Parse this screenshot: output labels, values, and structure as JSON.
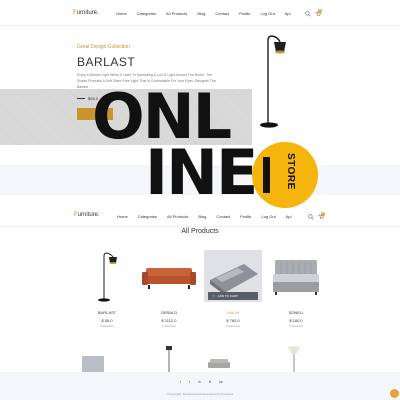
{
  "header": {
    "logo_prefix": "F",
    "logo_rest": "urniture.",
    "nav": [
      "Home",
      "Categories",
      "All Products",
      "Blog",
      "Contact",
      "Profile",
      "Log Out",
      "Api"
    ],
    "cart_count": "0"
  },
  "hero": {
    "subtitle": "Great Design Collection",
    "title": "BARLAST",
    "description": "Enjoy A Deluxe Light When It Used To Spreading A Lot Of Light Around The Room. The Shade Provides A Soft Glare-Free Light That Is Comfortable For Your Eyes. Designer The Barlast",
    "price": "$55.0"
  },
  "overlay": {
    "line1": "ONL",
    "line2": "INE",
    "store": "STORE"
  },
  "products_section": {
    "title": "All Products",
    "items": [
      {
        "name": "BARLAST",
        "price": "$ 55.0",
        "reviews": "0 Reviews"
      },
      {
        "name": "GERALD",
        "price": "$ 1112.0",
        "reviews": "0 Reviews"
      },
      {
        "name": "MALM",
        "price": "$ 780.0",
        "reviews": "0 Reviews",
        "add_to_cart": "ADD TO CART"
      },
      {
        "name": "SONELI",
        "price": "$ 180.0",
        "reviews": "0 Reviews"
      }
    ]
  },
  "footer": {
    "social": [
      "f",
      "t",
      "in",
      "B",
      "be"
    ],
    "copyright": "©copyright. Designed and Developed by Furniture"
  },
  "colors": {
    "accent": "#c9932e",
    "store_yellow": "#f5b50c"
  }
}
